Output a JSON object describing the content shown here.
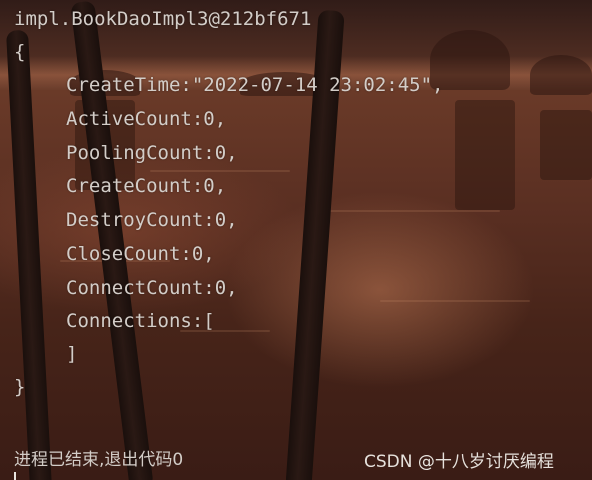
{
  "console": {
    "header": "impl.BookDaoImpl3@212bf671",
    "open_brace": "{",
    "fields": [
      "CreateTime:\"2022-07-14 23:02:45\",",
      "ActiveCount:0,",
      "PoolingCount:0,",
      "CreateCount:0,",
      "DestroyCount:0,",
      "CloseCount:0,",
      "ConnectCount:0,",
      "Connections:["
    ],
    "close_bracket": "]",
    "close_brace": "}",
    "exit_message": "进程已结束,退出代码0"
  },
  "watermark": {
    "text": "CSDN @十八岁讨厌编程"
  },
  "colors": {
    "console_text": "#d3cdc8",
    "background_dark": "#2b1712",
    "sunset_water": "#6a3a28"
  }
}
